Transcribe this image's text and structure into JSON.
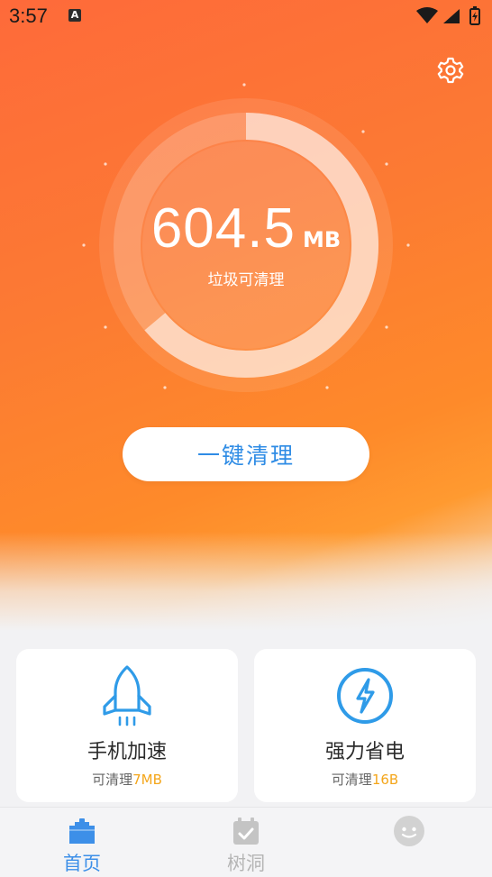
{
  "status_bar": {
    "time": "3:57",
    "notification_badge": "A"
  },
  "header": {
    "settings_icon": "gear-icon"
  },
  "gauge": {
    "value": "604.5",
    "unit": "MB",
    "label": "垃圾可清理",
    "fill_fraction": 0.62
  },
  "actions": {
    "clean_button": "一键清理"
  },
  "cards": [
    {
      "icon": "rocket-icon",
      "title": "手机加速",
      "sub_prefix": "可清理",
      "sub_value": "7MB"
    },
    {
      "icon": "lightning-icon",
      "title": "强力省电",
      "sub_prefix": "可清理",
      "sub_value": "16B"
    }
  ],
  "tabs": [
    {
      "label": "首页",
      "icon": "home-icon",
      "active": true
    },
    {
      "label": "树洞",
      "icon": "calendar-check-icon",
      "active": false
    },
    {
      "label": "",
      "icon": "avatar-icon",
      "active": false
    }
  ],
  "colors": {
    "accent": "#2f8ce5",
    "highlight": "#f4a61b",
    "hero_top": "#fe6a3a",
    "hero_bottom": "#ff9a30"
  }
}
